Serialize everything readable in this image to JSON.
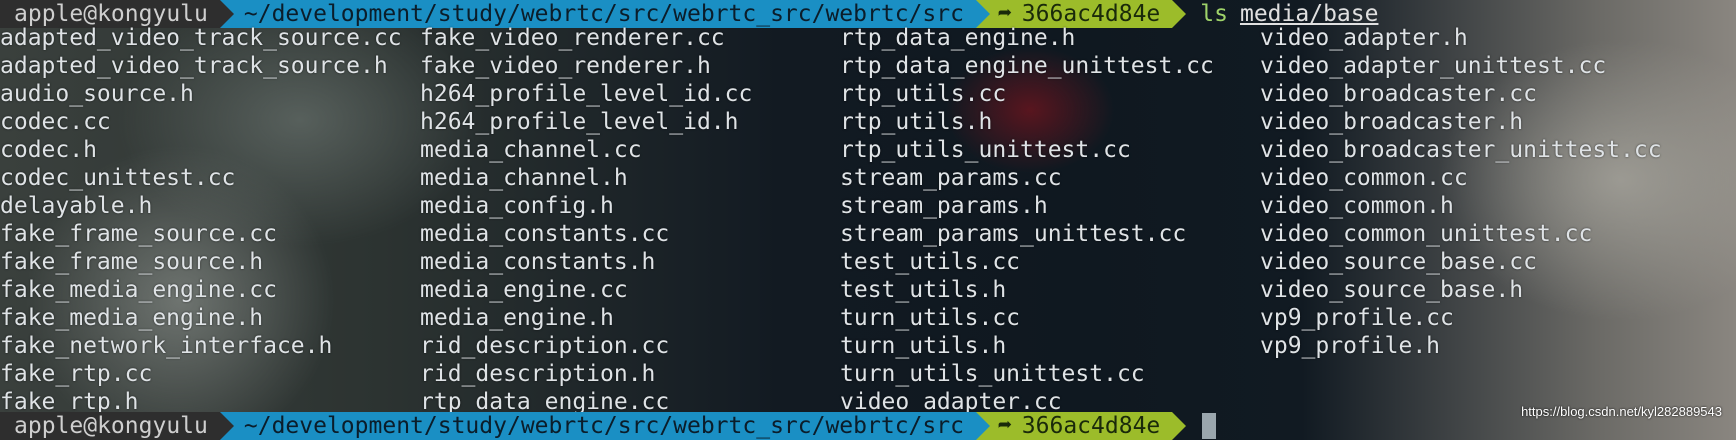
{
  "prompt": {
    "user_host": "apple@kongyulu",
    "path": "~/development/study/webrtc/src/webrtc_src/webrtc/src",
    "git_symbol": "➦",
    "git_commit": "366ac4d84e"
  },
  "command": {
    "name": "ls",
    "argument": "media/base"
  },
  "listing": {
    "columns": [
      [
        "adapted_video_track_source.cc",
        "adapted_video_track_source.h",
        "audio_source.h",
        "codec.cc",
        "codec.h",
        "codec_unittest.cc",
        "delayable.h",
        "fake_frame_source.cc",
        "fake_frame_source.h",
        "fake_media_engine.cc",
        "fake_media_engine.h",
        "fake_network_interface.h",
        "fake_rtp.cc",
        "fake_rtp.h"
      ],
      [
        "fake_video_renderer.cc",
        "fake_video_renderer.h",
        "h264_profile_level_id.cc",
        "h264_profile_level_id.h",
        "media_channel.cc",
        "media_channel.h",
        "media_config.h",
        "media_constants.cc",
        "media_constants.h",
        "media_engine.cc",
        "media_engine.h",
        "rid_description.cc",
        "rid_description.h",
        "rtp_data_engine.cc"
      ],
      [
        "rtp_data_engine.h",
        "rtp_data_engine_unittest.cc",
        "rtp_utils.cc",
        "rtp_utils.h",
        "rtp_utils_unittest.cc",
        "stream_params.cc",
        "stream_params.h",
        "stream_params_unittest.cc",
        "test_utils.cc",
        "test_utils.h",
        "turn_utils.cc",
        "turn_utils.h",
        "turn_utils_unittest.cc",
        "video_adapter.cc"
      ],
      [
        "video_adapter.h",
        "video_adapter_unittest.cc",
        "video_broadcaster.cc",
        "video_broadcaster.h",
        "video_broadcaster_unittest.cc",
        "video_common.cc",
        "video_common.h",
        "video_common_unittest.cc",
        "video_source_base.cc",
        "video_source_base.h",
        "vp9_profile.cc",
        "vp9_profile.h"
      ]
    ]
  },
  "watermark": "https://blog.csdn.net/kyl282889543",
  "colors": {
    "user_segment": "#2e2e2e",
    "path_segment": "#1a8fc4",
    "git_segment": "#9cbc2a",
    "command": "#9fd36a"
  }
}
